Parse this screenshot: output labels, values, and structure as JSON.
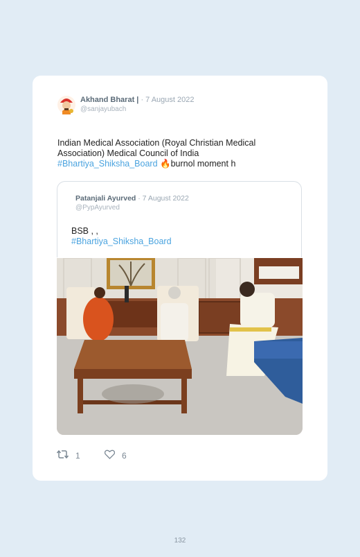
{
  "tweet": {
    "author_name": "Akhand Bharat |",
    "date": "· 7 August 2022",
    "handle": "@sanjayubach",
    "text_line1": "Indian Medical Association (Royal Christian Medical Association) Medical Council of India",
    "hashtag": "#Bhartiya_Shiksha_Board",
    "emoji": "🔥",
    "text_tail": "burnol moment h"
  },
  "quoted": {
    "author_name": "Patanjali Ayurved",
    "date": "· 7 August 2022",
    "handle": "@PypAyurved",
    "text_line1": "BSB , ,",
    "hashtag": "#Bhartiya_Shiksha_Board"
  },
  "actions": {
    "retweet_count": "1",
    "like_count": "6"
  },
  "footer": {
    "page_number": "132"
  },
  "icons": {
    "retweet": "retweet-icon",
    "like": "heart-icon"
  }
}
